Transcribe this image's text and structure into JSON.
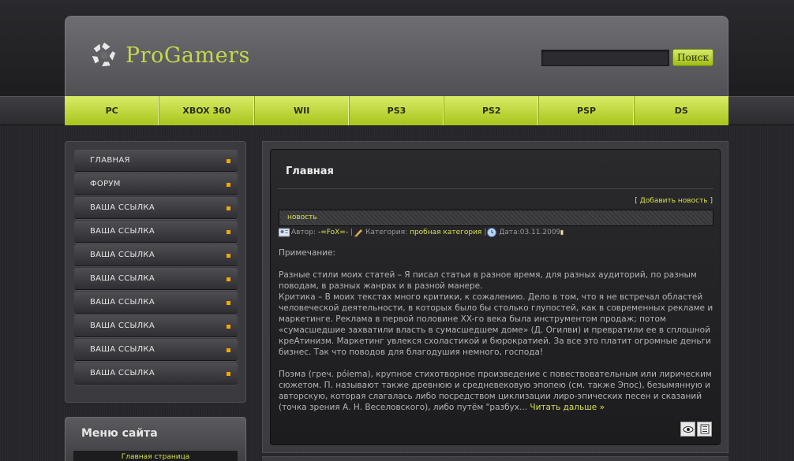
{
  "site": {
    "logo_text": "ProGamers",
    "search_button": "Поиск",
    "search_value": ""
  },
  "nav": [
    "PC",
    "XBOX 360",
    "WII",
    "PS3",
    "PS2",
    "PSP",
    "DS"
  ],
  "sidebar": {
    "items": [
      "ГЛАВНАЯ",
      "ФОРУМ",
      "ВАША ССЫЛКА",
      "ВАША ССЫЛКА",
      "ВАША ССЫЛКА",
      "ВАША ССЫЛКА",
      "ВАША ССЫЛКА",
      "ВАША ССЫЛКА",
      "ВАША ССЫЛКА",
      "ВАША ССЫЛКА"
    ],
    "menu_title": "Меню сайта",
    "menu_first_link": "Главная страница"
  },
  "content": {
    "title": "Главная",
    "add_news_open": "[ ",
    "add_news": "Добавить новость",
    "add_news_close": " ]",
    "news_label": "новость",
    "meta": {
      "author_label": "Автор:",
      "author": "-=FoX=-",
      "sep1": "|",
      "category_label": "Категория:",
      "category": "пробная категория",
      "sep2": "|",
      "date_label": "Дата:",
      "date": "03.11.2009"
    },
    "note": "Примечание:",
    "paragraph1": "Разные стили моих статей – Я писал статьи в разное время, для разных аудиторий, по разным поводам, в разных жанрах и в разной манере.",
    "paragraph2": "Критика – В моих текстах много критики, к сожалению. Дело в том, что я не встречал областей человеческой деятельности, в которых было бы столько глупостей, как в современных рекламе и маркетинге. Реклама в первой половине XX-го века была инструментом продаж; потом «сумасшедшие захватили власть в сумасшедшем доме» (Д. Огилви) и превратили ее в сплошной креАтинизм. Маркетинг увлекся схоластикой и бюрократией. За все это платит огромные деньги бизнес. Так что поводов для благодушия немного, господа!",
    "paragraph3": "Поэма (греч. póiema), крупное стихотворное произведение с повествовательным или лирическим сюжетом. П. называют также древнюю и средневековую эпопею (см. также Эпос), безымянную и авторскую, которая слагалась либо посредством циклизации лиро-эпических песен и сказаний (точка зрения А. Н. Веселовского), либо путём \"разбух...",
    "read_more": "Читать дальше »"
  },
  "colors": {
    "accent": "#c6d84a",
    "nav_green": "#b5cf2a",
    "bullet": "#f5a800"
  }
}
